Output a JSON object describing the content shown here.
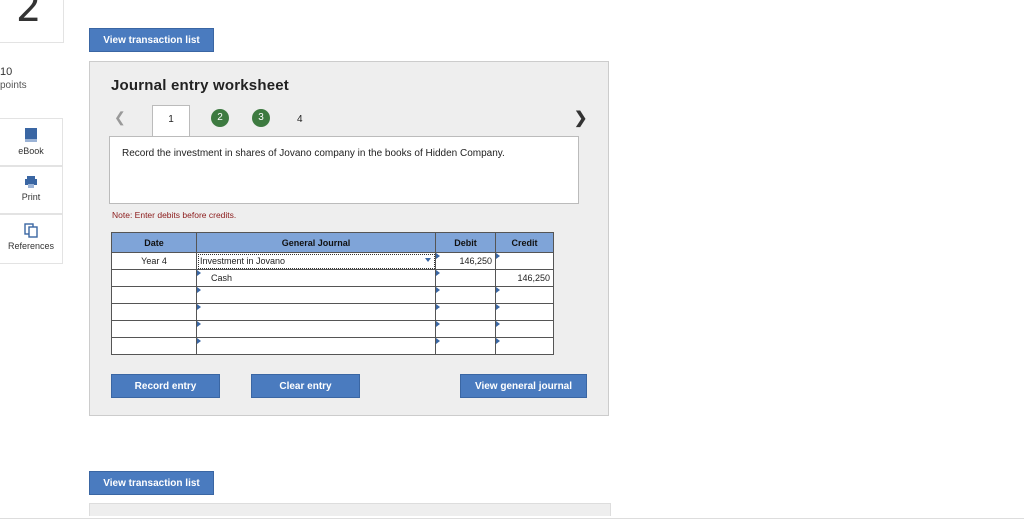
{
  "question": {
    "number": "2",
    "points_value": "10",
    "points_label": "points"
  },
  "sidebar": {
    "items": [
      {
        "label": "eBook",
        "icon": "book-icon"
      },
      {
        "label": "Print",
        "icon": "printer-icon"
      },
      {
        "label": "References",
        "icon": "copy-icon"
      }
    ]
  },
  "buttons": {
    "view_transaction_list_top": "View transaction list",
    "view_transaction_list_bottom": "View transaction list",
    "record_entry": "Record entry",
    "clear_entry": "Clear entry",
    "view_general_journal": "View general journal"
  },
  "worksheet": {
    "title": "Journal entry worksheet",
    "tabs": [
      "1",
      "2",
      "3",
      "4"
    ],
    "instruction": "Record the investment in shares of Jovano company in the books of Hidden Company.",
    "note": "Note: Enter debits before credits."
  },
  "journal": {
    "headers": [
      "Date",
      "General Journal",
      "Debit",
      "Credit"
    ],
    "rows": [
      {
        "date": "Year 4",
        "account": "Investment in Jovano",
        "debit": "146,250",
        "credit": ""
      },
      {
        "date": "",
        "account": "Cash",
        "debit": "",
        "credit": "146,250"
      },
      {
        "date": "",
        "account": "",
        "debit": "",
        "credit": ""
      },
      {
        "date": "",
        "account": "",
        "debit": "",
        "credit": ""
      },
      {
        "date": "",
        "account": "",
        "debit": "",
        "credit": ""
      },
      {
        "date": "",
        "account": "",
        "debit": "",
        "credit": ""
      }
    ]
  },
  "colors": {
    "button_blue": "#4a7bbf",
    "header_blue": "#7fa4d8",
    "tab_green": "#3d7a40",
    "note_red": "#8b1a1a"
  }
}
